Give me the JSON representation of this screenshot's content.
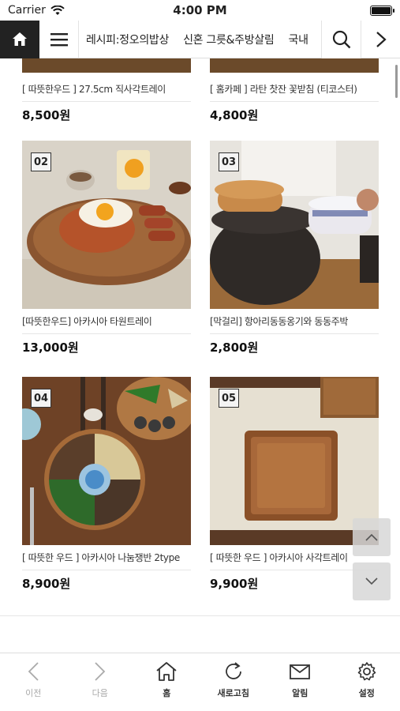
{
  "status_bar": {
    "carrier": "Carrier",
    "time": "4:00 PM"
  },
  "nav": {
    "categories": [
      "레시피:정오의밥상",
      "신혼 그릇&주방살림",
      "국내"
    ]
  },
  "top_partial": [
    {
      "name": "[ 따뜻한우드 ] 27.5cm 직사각트레이",
      "price": "8,500원"
    },
    {
      "name": "[ 홈카페 ] 라탄 찻잔 꽃받침 (티코스터)",
      "price": "4,800원"
    }
  ],
  "products": [
    {
      "badge": "02",
      "name": "[따뜻한우드] 아카시아 타원트레이",
      "price": "13,000원"
    },
    {
      "badge": "03",
      "name": "[막걸리] 항아리동동옹기와 동동주박",
      "price": "2,800원"
    },
    {
      "badge": "04",
      "name": "[ 따뜻한 우드 ] 아카시아 나눔쟁반 2type",
      "price": "8,900원"
    },
    {
      "badge": "05",
      "name": "[ 따뜻한 우드 ] 아카시아 사각트레이",
      "price": "9,900원"
    }
  ],
  "tabbar": {
    "prev": "이전",
    "next": "다음",
    "home": "홈",
    "refresh": "새로고침",
    "notice": "알림",
    "settings": "설정"
  },
  "colors": {
    "accent_dark": "#222222",
    "wood": "#8a5a30"
  }
}
